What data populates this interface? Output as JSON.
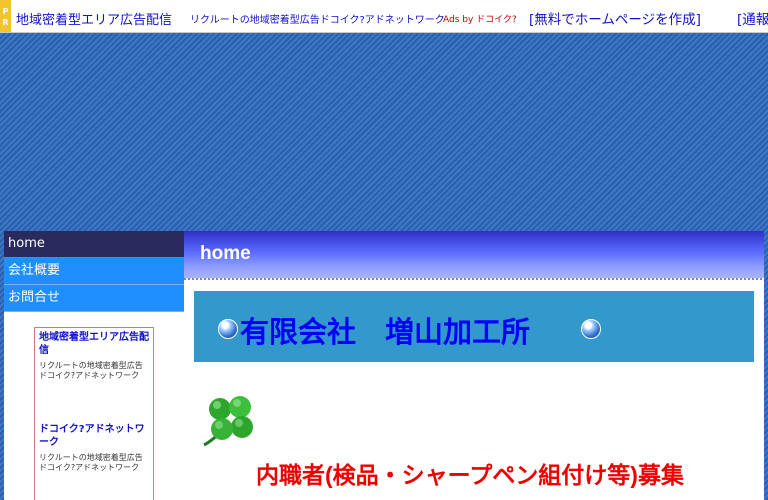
{
  "adbar": {
    "pr_letters": [
      "P",
      "R"
    ],
    "title": "地域密着型エリア広告配信",
    "description": "リクルートの地域密着型広告ドコイク?アドネットワーク",
    "ads_by": "Ads by ドコイク?",
    "free_homepage": "[無料でホームページを作成]",
    "report": "[通報"
  },
  "nav": {
    "items": [
      {
        "label": "home",
        "active": true
      },
      {
        "label": "会社概要",
        "active": false
      },
      {
        "label": "お問合せ",
        "active": false
      }
    ]
  },
  "side_ad": {
    "block1_title": "地域密着型エリア広告配信",
    "block1_desc": "リクルートの地域密着型広告ドコイク?アドネットワーク",
    "block2_title": "ドコイク?アドネットワーク",
    "block2_desc": "リクルートの地域密着型広告ドコイク?アドネットワーク"
  },
  "main": {
    "page_title": "home",
    "company_name": "有限会社　増山加工所",
    "recruit_heading": "内職者(検品・シャープペン組付け等)募集"
  },
  "icons": [
    "pr-badge",
    "orb-bullet-icon",
    "four-leaf-clover-icon"
  ],
  "colors": {
    "header_blue": "#3a50e8",
    "nav_active": "#2a2a5e",
    "nav_item": "#1f8fff",
    "company_band": "#3399cc",
    "company_text": "#0000ff",
    "recruit_text": "#ee0000",
    "ad_link": "#1111cc"
  }
}
